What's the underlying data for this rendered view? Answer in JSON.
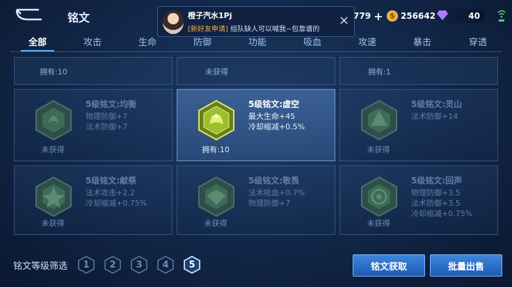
{
  "header": {
    "title": "铭文"
  },
  "currencies": {
    "a": "779",
    "b": "256642",
    "c": "40"
  },
  "tabs": [
    {
      "label": "全部",
      "active": true
    },
    {
      "label": "攻击"
    },
    {
      "label": "生命"
    },
    {
      "label": "防御"
    },
    {
      "label": "功能"
    },
    {
      "label": "吸血"
    },
    {
      "label": "攻速"
    },
    {
      "label": "暴击"
    },
    {
      "label": "穿透"
    }
  ],
  "top_row": [
    "拥有:10",
    "未获得",
    "拥有:1"
  ],
  "cards": [
    {
      "name": "5级铭文:均衡",
      "stats": [
        "物理防御+7",
        "法术防御+7"
      ],
      "footer": "未获得",
      "color": "#4f8a68"
    },
    {
      "name": "5级铭文:虚空",
      "stats": [
        "最大生命+45",
        "冷却缩减+0.5%"
      ],
      "footer": "拥有:10",
      "color": "#8fae2a"
    },
    {
      "name": "5级铭文:灵山",
      "stats": [
        "法术防御+14"
      ],
      "footer": "未获得",
      "color": "#4f8a68"
    },
    {
      "name": "5级铭文:献祭",
      "stats": [
        "法术攻击+2.2",
        "冷却缩减+0.75%"
      ],
      "footer": "未获得",
      "color": "#4f8a68"
    },
    {
      "name": "5级铭文:敬畏",
      "stats": [
        "法术吸血+0.7%",
        "物理防御+7"
      ],
      "footer": "未获得",
      "color": "#4f8a68"
    },
    {
      "name": "5级铭文:回声",
      "stats": [
        "物理防御+3.5",
        "法术防御+3.5",
        "冷却缩减+0.75%"
      ],
      "footer": "未获得",
      "color": "#4f8a68"
    }
  ],
  "footer": {
    "filter_label": "铭文等级筛选",
    "levels": [
      "1",
      "2",
      "3",
      "4",
      "5"
    ],
    "selected_level": "5",
    "acquire_label": "铭文获取",
    "sell_label": "批量出售"
  },
  "notification": {
    "name": "橙子汽水1Pj",
    "tag": "[新好友申请]",
    "message": "组队缺人可以喊我~包靠谱的",
    "close": "×"
  },
  "colors": {
    "accent": "#3d86dd",
    "background": "#132a4c",
    "active_tab_underline": "#5fb3ff"
  }
}
